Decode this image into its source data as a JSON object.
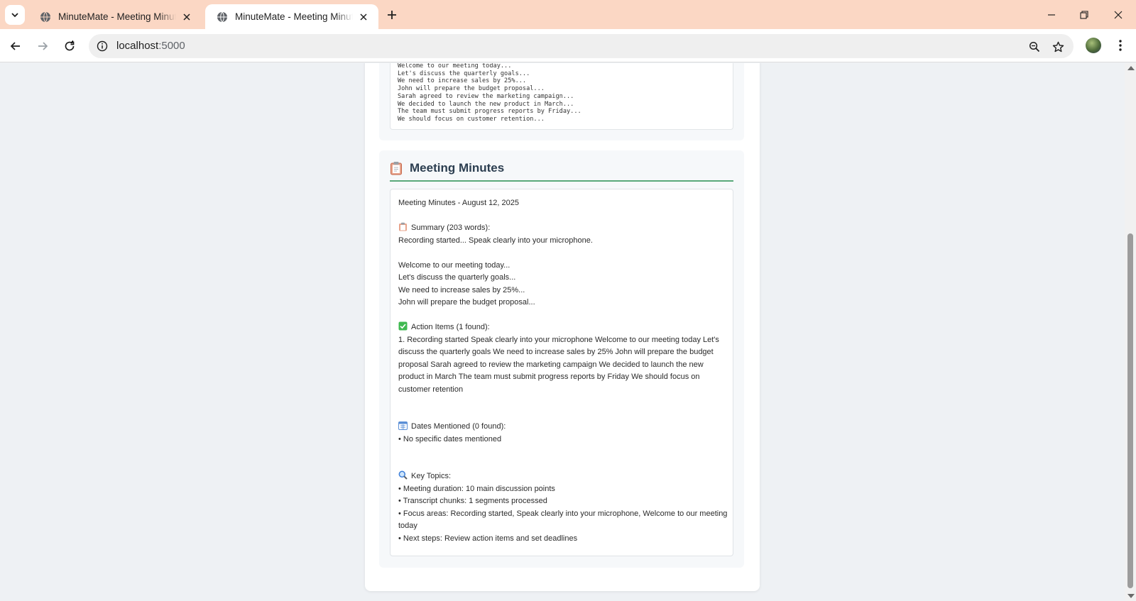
{
  "browser": {
    "tabs": [
      {
        "title": "MinuteMate - Meeting Minutes",
        "active": false
      },
      {
        "title": "MinuteMate - Meeting Minutes",
        "active": true
      }
    ],
    "url_host": "localhost",
    "url_port": ":5000"
  },
  "transcript": {
    "lines": [
      "Welcome to our meeting today...",
      "Let's discuss the quarterly goals...",
      "We need to increase sales by 25%...",
      "John will prepare the budget proposal...",
      "Sarah agreed to review the marketing campaign...",
      "We decided to launch the new product in March...",
      "The team must submit progress reports by Friday...",
      "We should focus on customer retention..."
    ]
  },
  "minutes": {
    "section_title": "Meeting Minutes",
    "heading": "Meeting Minutes - August 12, 2025",
    "summary_label": "Summary (203 words):",
    "summary_lines": [
      "Recording started... Speak clearly into your microphone.",
      "",
      "Welcome to our meeting today...",
      "Let's discuss the quarterly goals...",
      "We need to increase sales by 25%...",
      "John will prepare the budget proposal..."
    ],
    "action_label": "Action Items (1 found):",
    "action_item": "1. Recording started Speak clearly into your microphone Welcome to our meeting today Let's discuss the quarterly goals We need to increase sales by 25% John will prepare the budget proposal Sarah agreed to review the marketing campaign We decided to launch the new product in March The team must submit progress reports by Friday We should focus on customer retention",
    "dates_label": "Dates Mentioned (0 found):",
    "dates_item": "• No specific dates mentioned",
    "topics_label": "Key Topics:",
    "topics": [
      "• Meeting duration: 10 main discussion points",
      "• Transcript chunks: 1 segments processed",
      "• Focus areas: Recording started, Speak clearly into your microphone, Welcome to our meeting today",
      "• Next steps: Review action items and set deadlines"
    ]
  },
  "colors": {
    "tabbar": "#fbd7c4",
    "accent_green": "#5aa97a",
    "heading": "#2c3e50"
  },
  "icons": [
    "globe-icon",
    "close-icon",
    "plus-icon",
    "back-icon",
    "forward-icon",
    "reload-icon",
    "info-icon",
    "zoom-icon",
    "star-icon",
    "clipboard-icon",
    "checkmark-icon",
    "calendar-icon",
    "magnifier-icon"
  ]
}
